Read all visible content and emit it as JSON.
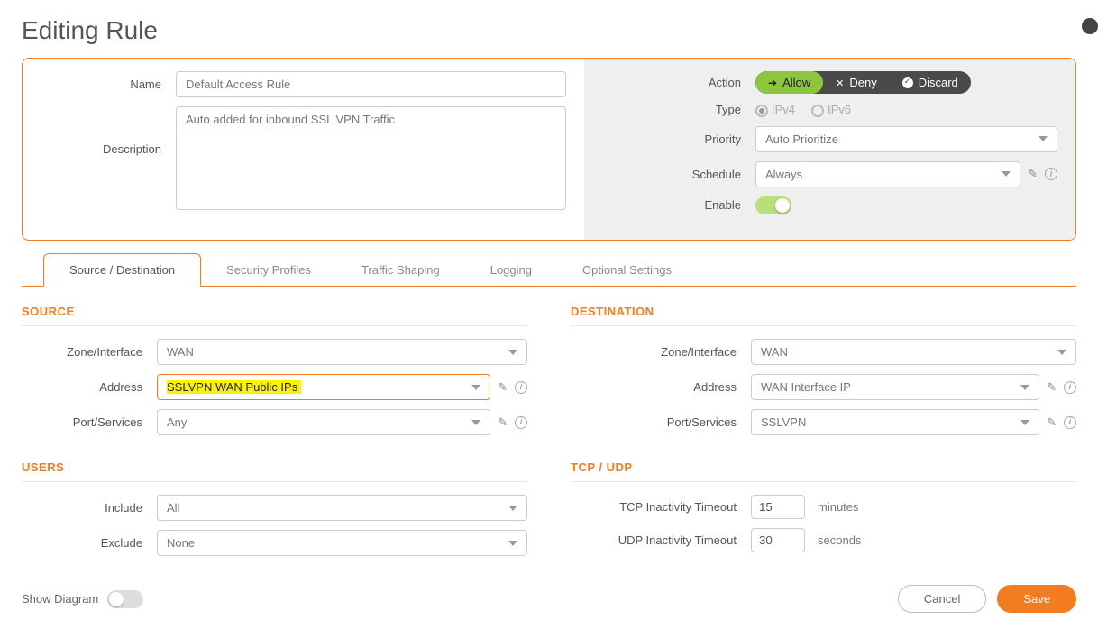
{
  "page_title": "Editing Rule",
  "top": {
    "name_label": "Name",
    "name_value": "Default Access Rule",
    "description_label": "Description",
    "description_value": "Auto added for inbound SSL VPN Traffic",
    "action_label": "Action",
    "action": {
      "allow": "Allow",
      "deny": "Deny",
      "discard": "Discard",
      "selected": "allow"
    },
    "type_label": "Type",
    "type": {
      "ipv4": "IPv4",
      "ipv6": "IPv6",
      "selected": "ipv4"
    },
    "priority_label": "Priority",
    "priority_value": "Auto Prioritize",
    "schedule_label": "Schedule",
    "schedule_value": "Always",
    "enable_label": "Enable",
    "enable_on": true
  },
  "tabs": {
    "t0": "Source / Destination",
    "t1": "Security Profiles",
    "t2": "Traffic Shaping",
    "t3": "Logging",
    "t4": "Optional Settings"
  },
  "source": {
    "title": "SOURCE",
    "zone_label": "Zone/Interface",
    "zone_value": "WAN",
    "address_label": "Address",
    "address_value": "SSLVPN WAN Public IPs",
    "port_label": "Port/Services",
    "port_value": "Any"
  },
  "destination": {
    "title": "DESTINATION",
    "zone_label": "Zone/Interface",
    "zone_value": "WAN",
    "address_label": "Address",
    "address_value": "WAN Interface IP",
    "port_label": "Port/Services",
    "port_value": "SSLVPN"
  },
  "users": {
    "title": "USERS",
    "include_label": "Include",
    "include_value": "All",
    "exclude_label": "Exclude",
    "exclude_value": "None"
  },
  "tcpudp": {
    "title": "TCP / UDP",
    "tcp_label": "TCP Inactivity Timeout",
    "tcp_value": "15",
    "tcp_unit": "minutes",
    "udp_label": "UDP Inactivity Timeout",
    "udp_value": "30",
    "udp_unit": "seconds"
  },
  "footer": {
    "show_diagram": "Show Diagram",
    "cancel": "Cancel",
    "save": "Save"
  }
}
